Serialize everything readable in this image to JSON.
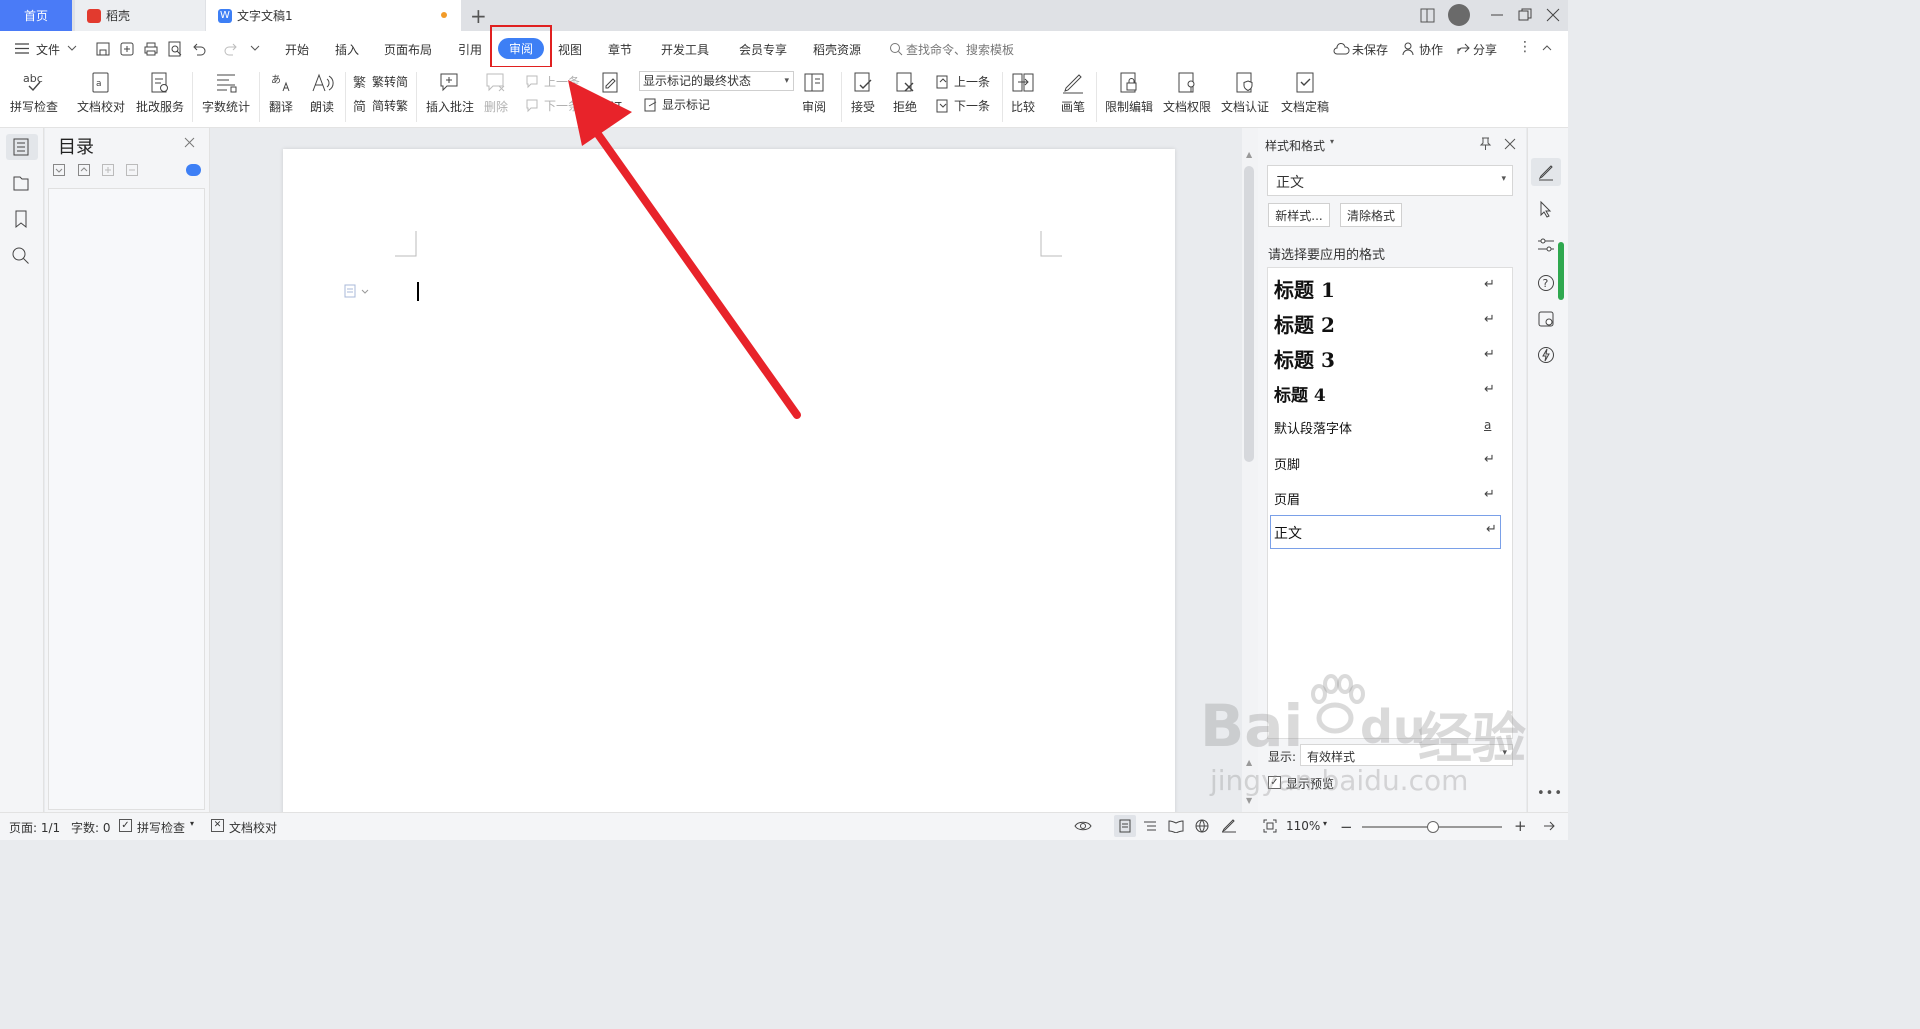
{
  "tabs": {
    "home": "首页",
    "daoke": "稻壳",
    "doc": "文字文稿1",
    "add": "+"
  },
  "menu": {
    "file": "文件",
    "tabs": [
      "开始",
      "插入",
      "页面布局",
      "引用",
      "审阅",
      "视图",
      "章节",
      "开发工具",
      "会员专享",
      "稻壳资源"
    ],
    "search": "查找命令、搜索模板",
    "unsaved": "未保存",
    "collab": "协作",
    "share": "分享"
  },
  "ribbon": {
    "spell": "拼写检查",
    "proof": "文档校对",
    "correct": "批改服务",
    "wordcount": "字数统计",
    "translate": "翻译",
    "read": "朗读",
    "t2s": "繁转简",
    "s2t": "简转繁",
    "insert_comment": "插入批注",
    "delete": "删除",
    "prev": "上一条",
    "next": "下一条",
    "revise": "修订",
    "markup_select": "显示标记的最终状态",
    "show_markup": "显示标记",
    "review": "审阅",
    "accept": "接受",
    "reject": "拒绝",
    "prev2": "上一条",
    "next2": "下一条",
    "compare": "比较",
    "pen": "画笔",
    "restrict": "限制编辑",
    "permission": "文档权限",
    "certify": "文档认证",
    "finalize": "文档定稿"
  },
  "toc": {
    "title": "目录"
  },
  "styles_panel": {
    "title": "样式和格式",
    "current": "正文",
    "new_style": "新样式...",
    "clear_format": "清除格式",
    "prompt": "请选择要应用的格式",
    "items": [
      "标题  1",
      "标题  2",
      "标题  3",
      "标题  4",
      "默认段落字体",
      "页脚",
      "页眉",
      "正文"
    ],
    "show_label": "显示:",
    "show_value": "有效样式",
    "preview": "显示预览"
  },
  "status": {
    "page": "页面: 1/1",
    "words": "字数: 0",
    "spell": "拼写检查",
    "proof": "文档校对",
    "zoom": "110%"
  },
  "watermark": {
    "brand": "Bai",
    "du": "du",
    "jingyan": "经验",
    "url": "jingyan.baidu.com"
  },
  "colors": {
    "accent": "#3d7ff5",
    "highlight": "#e02020",
    "arrow": "#e8232a"
  }
}
